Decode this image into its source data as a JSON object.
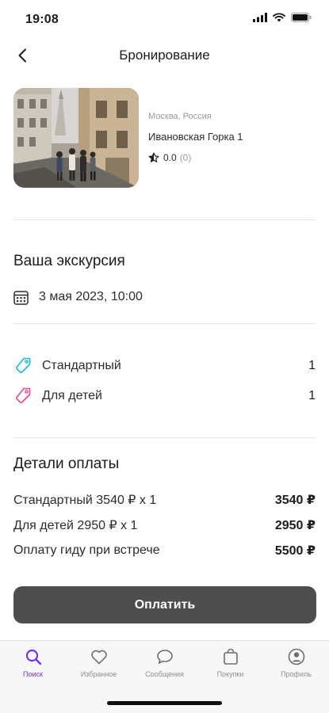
{
  "status_bar": {
    "time": "19:08"
  },
  "nav": {
    "title": "Бронирование"
  },
  "tour": {
    "city": "Москва, Россия",
    "title": "Ивановская Горка 1",
    "rating": "0.0",
    "reviews": "(0)"
  },
  "excursion": {
    "section_title": "Ваша экскурсия",
    "date": "3 мая 2023, 10:00"
  },
  "tickets": [
    {
      "label": "Стандартный",
      "qty": "1",
      "icon": "ticket-tag-icon",
      "color": "#1fb5d6"
    },
    {
      "label": "Для детей",
      "qty": "1",
      "icon": "ticket-tag-icon",
      "color": "#e24b8e"
    }
  ],
  "payment": {
    "section_title": "Детали оплаты",
    "rows": [
      {
        "name": "Стандартный 3540 ₽ x 1",
        "amount": "3540 ₽"
      },
      {
        "name": "Для детей 2950 ₽ x 1",
        "amount": "2950 ₽"
      },
      {
        "name": "Оплату гиду при встрече",
        "amount": "5500 ₽"
      }
    ],
    "button_label": "Оплатить"
  },
  "tabs": [
    {
      "label": "Поиск",
      "icon": "search-icon",
      "active": true
    },
    {
      "label": "Избранное",
      "icon": "heart-icon",
      "active": false
    },
    {
      "label": "Сообщения",
      "icon": "chat-icon",
      "active": false
    },
    {
      "label": "Покупки",
      "icon": "bag-icon",
      "active": false
    },
    {
      "label": "Профиль",
      "icon": "profile-icon",
      "active": false
    }
  ],
  "colors": {
    "accent": "#7b2ff7",
    "button": "#4e4e4e",
    "ticket_standard": "#1fb5d6",
    "ticket_child": "#e24b8e"
  }
}
